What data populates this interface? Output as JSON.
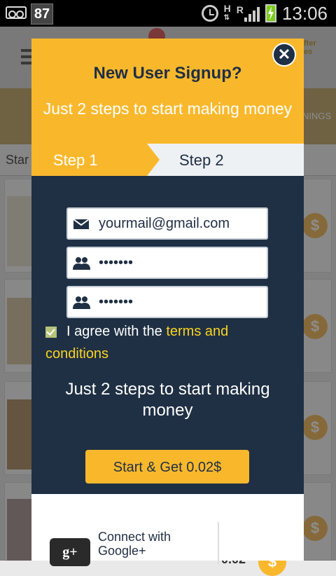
{
  "status_bar": {
    "notification_count": "87",
    "network": "H",
    "roaming": "R",
    "time": "13:06"
  },
  "background": {
    "start_label": "Star",
    "tab_label": "NINGS",
    "after_label": "fter\nes",
    "amount_label": "0.02",
    "coin_symbol": "$"
  },
  "modal": {
    "title": "New User Signup?",
    "subtitle": "Just 2 steps to start making money",
    "close_symbol": "✕",
    "steps": {
      "step1": "Step 1",
      "step2": "Step 2"
    },
    "form": {
      "email_value": "yourmail@gmail.com",
      "password_value": "•••••••",
      "confirm_password_value": "•••••••",
      "agree_text": "I agree with the ",
      "terms_link": "terms and conditions",
      "agree_checked": true,
      "panel_text": "Just 2 steps to start making money",
      "start_button": "Start & Get 0.02$"
    },
    "footer": {
      "gplus_icon_text": "g+",
      "gplus_label": "Connect with Google+"
    }
  },
  "colors": {
    "accent": "#f9b82c",
    "navy": "#1f3044",
    "terms_link": "#f9d321"
  }
}
